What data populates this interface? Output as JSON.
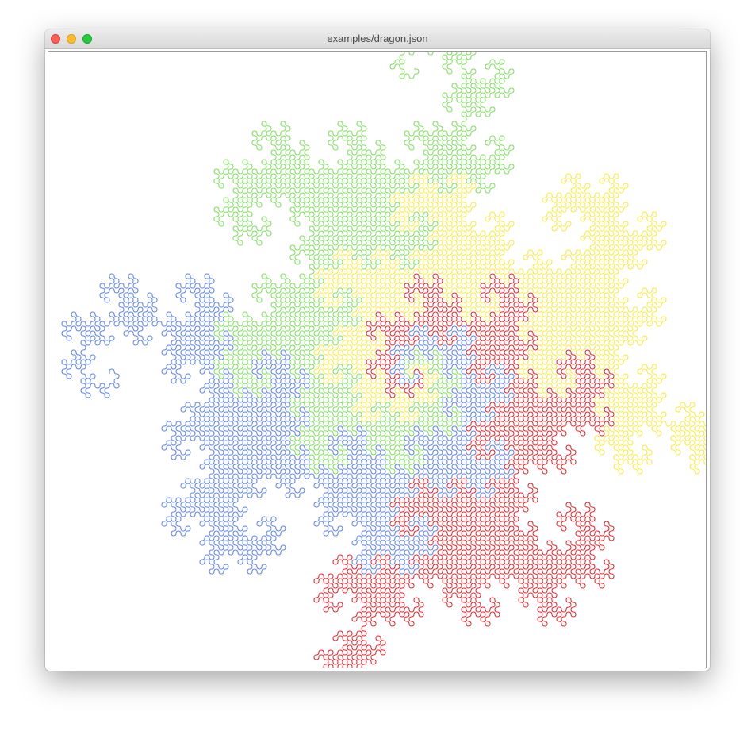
{
  "window": {
    "title": "examples/dragon.json",
    "buttons": [
      "close",
      "minimize",
      "zoom"
    ]
  },
  "drawing": {
    "type": "dragon-curve",
    "iterations": 12,
    "curves": [
      {
        "name": "red",
        "color": "#e0222a"
      },
      {
        "name": "yellow",
        "color": "#f7ea3a"
      },
      {
        "name": "green",
        "color": "#7ede5c"
      },
      {
        "name": "blue",
        "color": "#5b7fe6"
      }
    ]
  }
}
